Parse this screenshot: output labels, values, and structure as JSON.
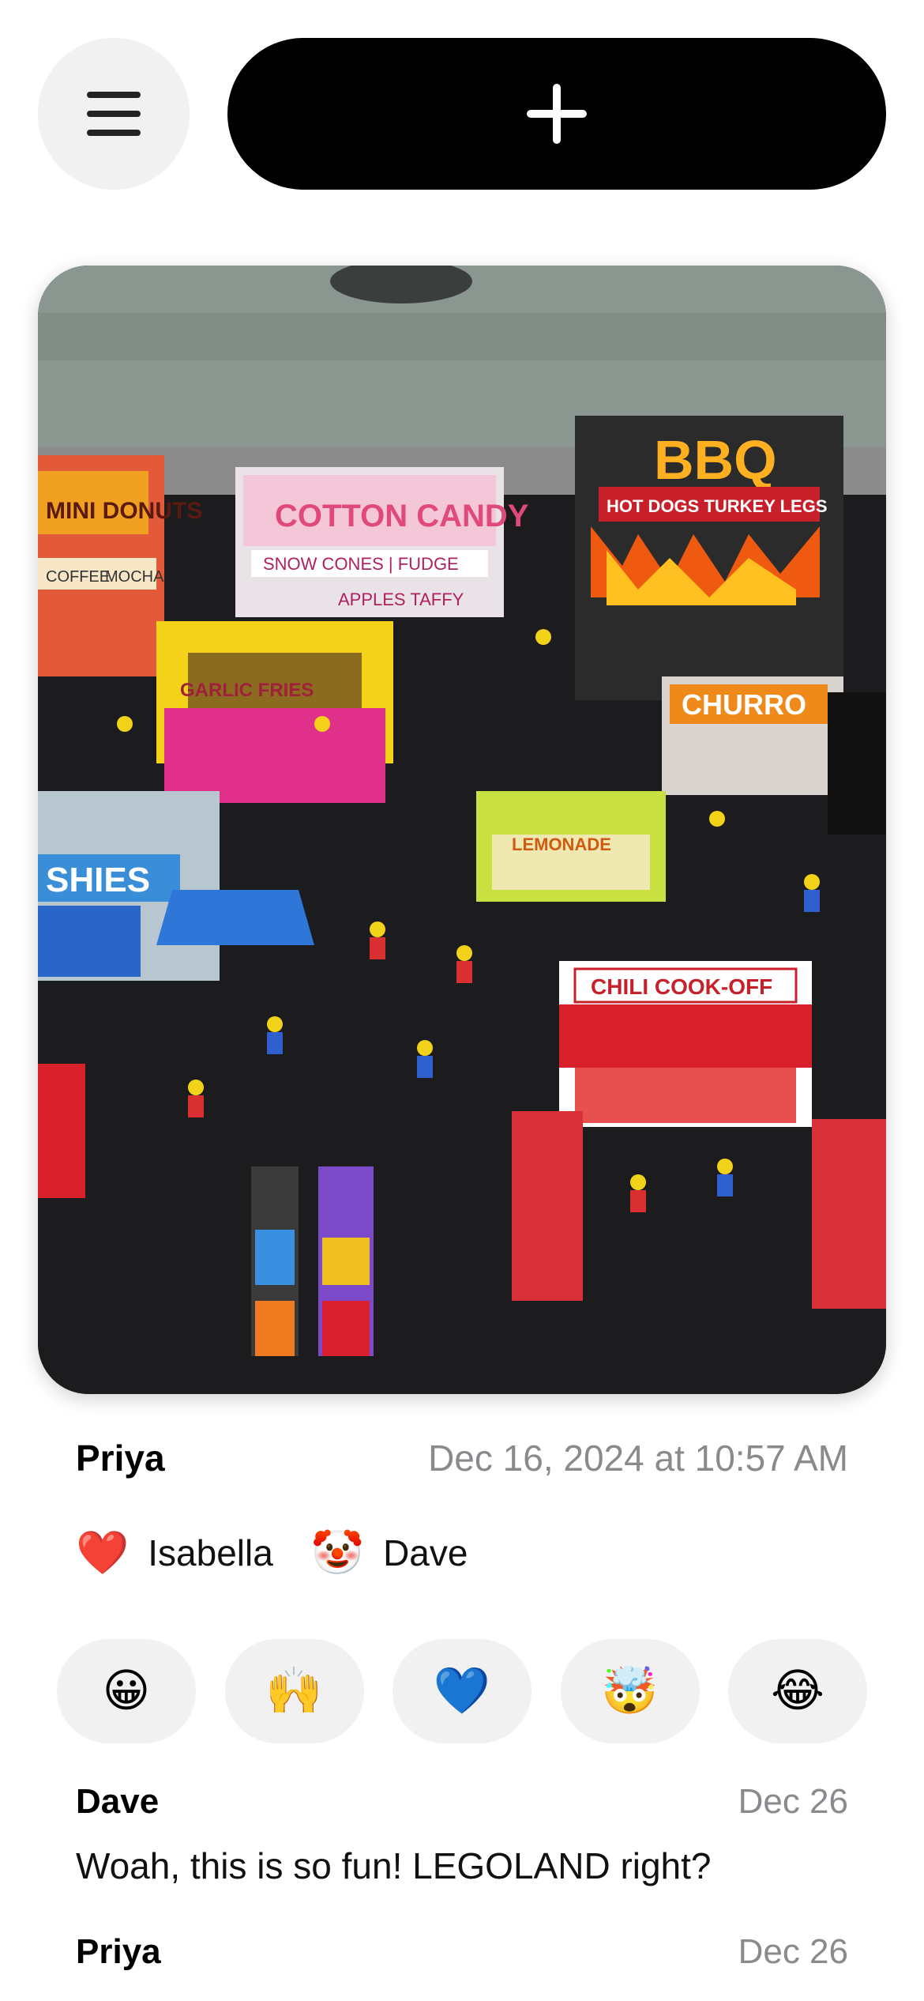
{
  "toolbar": {
    "menu_icon": "hamburger-icon",
    "add_icon": "plus-icon"
  },
  "post": {
    "image_alt": "LEGO fair food stalls",
    "sign_texts": {
      "bbq": "BBQ",
      "hot_dogs": "HOT DOGS TURKEY LEGS",
      "cotton_candy": "COTTON CANDY",
      "snow_cones": "SNOW CONES | FUDGE",
      "apples": "APPLES TAFFY",
      "donuts": "MINI DONUTS",
      "mocha": "MOCHA",
      "coffee": "COFFEE",
      "garlic_fries": "GARLIC FRIES",
      "churro": "CHURRO",
      "lemonade": "LEMONADE",
      "shies": "SHIES",
      "chili": "CHILI COOK-OFF"
    },
    "author": "Priya",
    "timestamp": "Dec 16, 2024 at 10:57 AM",
    "reactions": [
      {
        "emoji": "❤️",
        "name": "Isabella"
      },
      {
        "emoji": "🤡",
        "name": "Dave"
      }
    ]
  },
  "emoji_bar": [
    "😀",
    "🙌",
    "💙",
    "🤯",
    "😂"
  ],
  "comments": [
    {
      "author": "Dave",
      "date": "Dec 26",
      "text": "Woah, this is so fun! LEGOLAND right?"
    },
    {
      "author": "Priya",
      "date": "Dec 26",
      "text": ""
    }
  ]
}
